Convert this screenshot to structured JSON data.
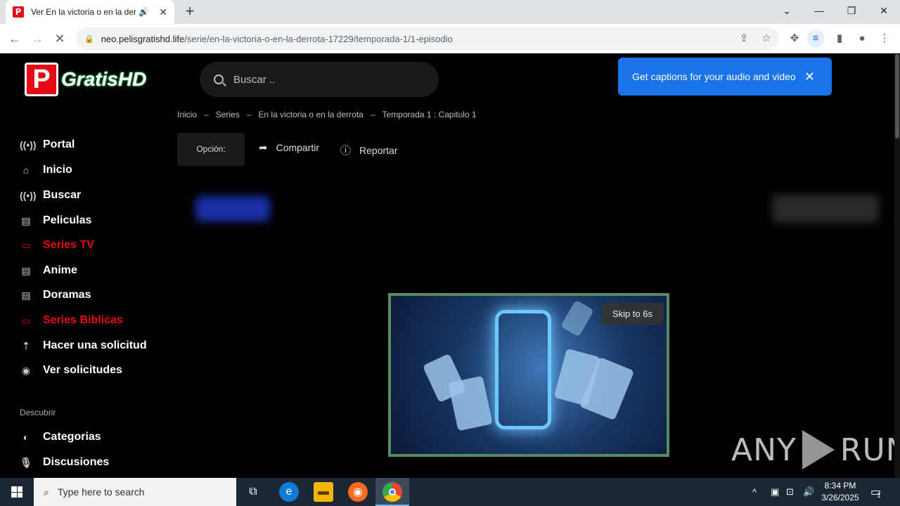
{
  "browser": {
    "tab_title": "Ver En la victoria o en la derrota",
    "favicon_letter": "P",
    "url_host": "neo.pelisgratishd.life",
    "url_path": "/serie/en-la-victoria-o-en-la-derrota-17229/temporada-1/1-episodio"
  },
  "site": {
    "logo_letter": "P",
    "logo_text": "GratisHD",
    "search_placeholder": "Buscar .."
  },
  "breadcrumb": [
    "Inicio",
    "Series",
    "En la victoria o en la derrota",
    "Temporada 1 : Capitulo 1"
  ],
  "breadcrumb_sep": "–",
  "actions": {
    "opcion": "Opción:",
    "share": "Compartir",
    "report": "Reportar"
  },
  "sidebar": {
    "items": [
      {
        "label": "Portal",
        "icon": "broadcast-icon"
      },
      {
        "label": "Inicio",
        "icon": "home-icon"
      },
      {
        "label": "Buscar",
        "icon": "broadcast-icon"
      },
      {
        "label": "Peliculas",
        "icon": "film-icon"
      },
      {
        "label": "Series TV",
        "icon": "tv-icon",
        "active": true
      },
      {
        "label": "Anime",
        "icon": "film-icon"
      },
      {
        "label": "Doramas",
        "icon": "film-icon"
      },
      {
        "label": "Series Biblicas",
        "icon": "tv-icon",
        "active": true
      },
      {
        "label": "Hacer una solicitud",
        "icon": "upload-icon"
      },
      {
        "label": "Ver solicitudes",
        "icon": "eye-icon"
      }
    ],
    "section_label": "Descubrir",
    "discover_items": [
      {
        "label": "Categorias",
        "icon": "half-circle-icon"
      },
      {
        "label": "Discusiones",
        "icon": "mic-icon"
      }
    ]
  },
  "ad": {
    "skip_label": "Skip to 6s"
  },
  "caption_popup": {
    "text": "Get captions for your audio and video"
  },
  "watermark": {
    "left": "ANY",
    "right": "RUN"
  },
  "taskbar": {
    "search_placeholder": "Type here to search",
    "time": "8:34 PM",
    "date": "3/26/2025",
    "notification_count": "1"
  },
  "colors": {
    "accent_red": "#e50914",
    "popup_blue": "#1a73e8",
    "ad_border": "#5a8a5f"
  }
}
